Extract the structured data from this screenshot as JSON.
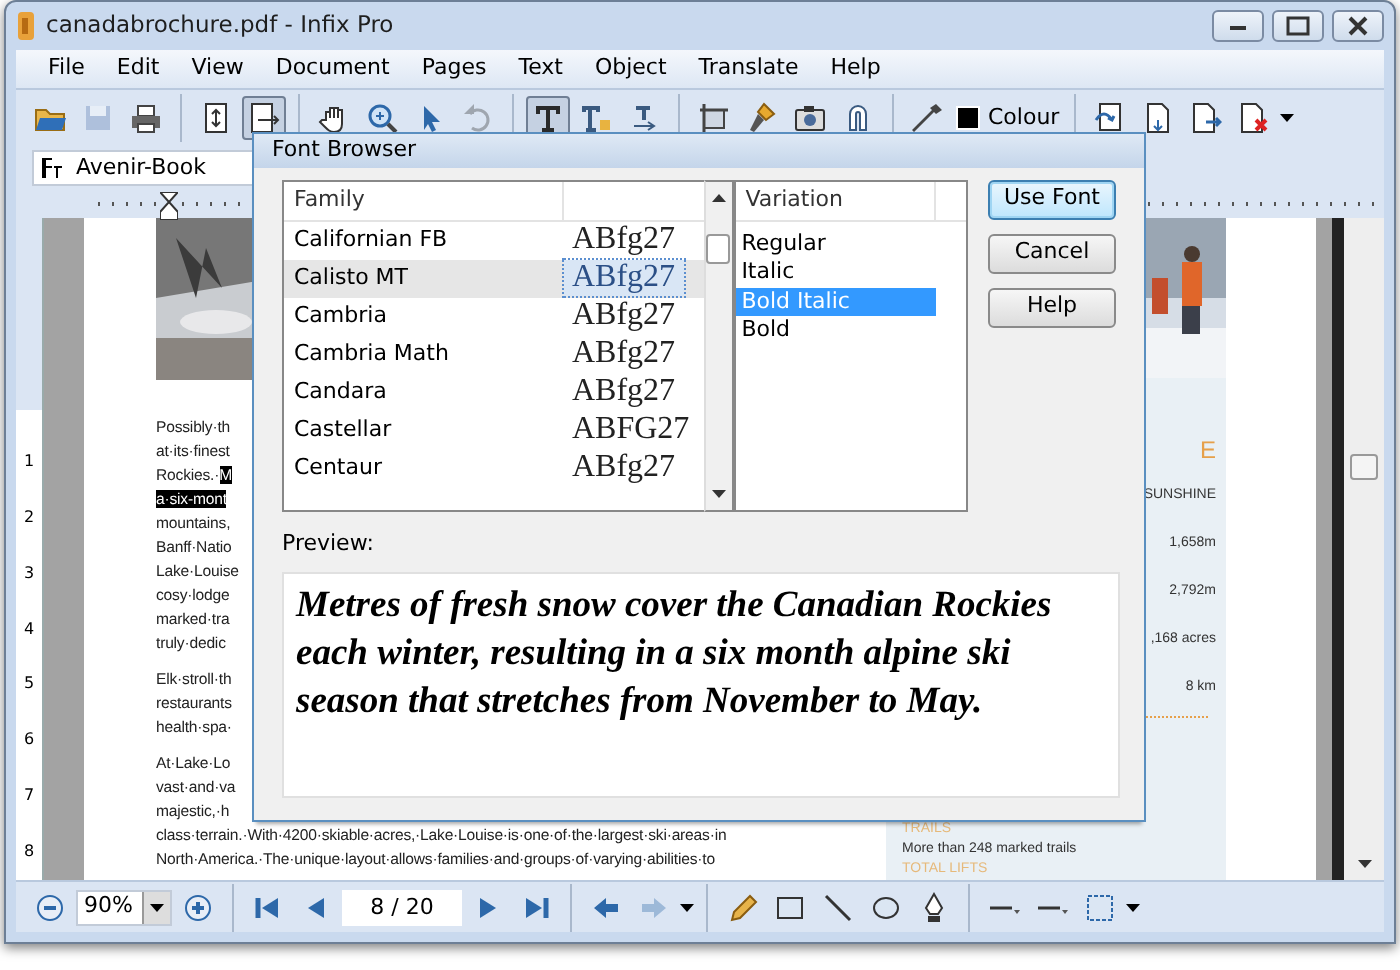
{
  "window": {
    "title": "canadabrochure.pdf - Infix Pro"
  },
  "menu": [
    "File",
    "Edit",
    "View",
    "Document",
    "Pages",
    "Text",
    "Object",
    "Translate",
    "Help"
  ],
  "toolbar": {
    "groups": [
      [
        {
          "pressed": false,
          "disabled": false
        },
        {
          "pressed": false,
          "disabled": true
        },
        {
          "pressed": false,
          "disabled": false
        }
      ],
      [
        {
          "pressed": false,
          "disabled": false
        },
        {
          "pressed": true,
          "disabled": false
        }
      ],
      [
        {
          "pressed": false,
          "disabled": false
        },
        {
          "pressed": false,
          "disabled": false
        },
        {
          "pressed": false,
          "disabled": false
        },
        {
          "pressed": false,
          "disabled": true
        }
      ],
      [
        {
          "pressed": true,
          "disabled": false
        },
        {
          "pressed": false,
          "disabled": false
        },
        {
          "pressed": false,
          "disabled": false
        }
      ],
      [
        {
          "pressed": false,
          "disabled": false
        },
        {
          "pressed": false,
          "disabled": false
        },
        {
          "pressed": false,
          "disabled": false
        },
        {
          "pressed": false,
          "disabled": false
        }
      ],
      [
        {
          "pressed": false,
          "disabled": false
        },
        {
          "pressed": false,
          "disabled": false,
          "label": "Colour"
        }
      ],
      [
        {
          "pressed": false,
          "disabled": false
        },
        {
          "pressed": false,
          "disabled": false
        },
        {
          "pressed": false,
          "disabled": false
        },
        {
          "pressed": false,
          "disabled": false
        }
      ]
    ]
  },
  "font_bar": {
    "font": "Avenir-Book"
  },
  "vertical_ruler": {
    "labels": [
      "1",
      "2",
      "3",
      "4",
      "5",
      "6",
      "7",
      "8"
    ]
  },
  "document": {
    "left_column": [
      [
        {
          "text": "Possibly·th"
        },
        {
          "text": "at·its·finest"
        },
        {
          "text": "Rockies.·",
          "selected_text": "M"
        },
        {
          "selected_text": "a·six-mont"
        },
        {
          "text": "mountains,"
        },
        {
          "text": "Banff·Natio"
        },
        {
          "text": "Lake·Louise"
        },
        {
          "text": "cosy·lodge"
        },
        {
          "text": "marked·tra"
        },
        {
          "text": "truly·dedic"
        }
      ],
      [
        {
          "text": "Elk·stroll·th"
        },
        {
          "text": "restaurants"
        },
        {
          "text": "health·spa·"
        }
      ],
      [
        {
          "text": "At·Lake·Lo"
        },
        {
          "text": "vast·and·va"
        },
        {
          "text": "majestic,·h"
        },
        {
          "text": "class·terrain.·With·4200·skiable·acres,·Lake·Louise·is·one·of·the·largest·ski·areas·in"
        },
        {
          "text": "North·America.·The·unique·layout·allows·families·and·groups·of·varying·abilities·to"
        }
      ]
    ],
    "right_panel": [
      {
        "kind": "heading",
        "text": "E"
      },
      {
        "kind": "stat",
        "text": "SUNSHINE"
      },
      {
        "kind": "stat",
        "text": "1,658m"
      },
      {
        "kind": "stat",
        "text": "2,792m"
      },
      {
        "kind": "stat",
        "text": ",168 acres"
      },
      {
        "kind": "stat",
        "text": "8 km"
      }
    ],
    "right_panel_bottom": [
      {
        "kind": "heading",
        "text": "TRAILS"
      },
      {
        "kind": "body",
        "text": "More than 248 marked trails"
      },
      {
        "kind": "heading",
        "text": "TOTAL LIFTS"
      }
    ]
  },
  "dialog": {
    "title": "Font Browser",
    "family_header": "Family",
    "families": [
      {
        "name": "Californian FB",
        "sample": "ABfg27",
        "selected": false
      },
      {
        "name": "Calisto MT",
        "sample": "ABfg27",
        "selected": true
      },
      {
        "name": "Cambria",
        "sample": "ABfg27",
        "selected": false
      },
      {
        "name": "Cambria Math",
        "sample": "ABfg27",
        "selected": false
      },
      {
        "name": "Candara",
        "sample": "ABfg27",
        "selected": false
      },
      {
        "name": "Castellar",
        "sample": "ABFG27",
        "selected": false
      },
      {
        "name": "Centaur",
        "sample": "ABfg27",
        "selected": false
      }
    ],
    "variation_header": "Variation",
    "variations": [
      {
        "label": "Regular",
        "selected": false
      },
      {
        "label": "Italic",
        "selected": false
      },
      {
        "label": "Bold Italic",
        "selected": true
      },
      {
        "label": "Bold",
        "selected": false
      }
    ],
    "buttons": [
      {
        "label": "Use Font",
        "default": true
      },
      {
        "label": "Cancel",
        "default": false
      },
      {
        "label": "Help",
        "default": false
      }
    ],
    "preview_label": "Preview:",
    "preview_text": "Metres of fresh snow cover the Canadian Rockies each winter, resulting in a six month alpine ski season that stretches from November to May."
  },
  "bottom_bar": {
    "zoom": "90%",
    "page": "8 / 20",
    "history": [
      {
        "disabled": false
      },
      {
        "disabled": true
      }
    ]
  }
}
